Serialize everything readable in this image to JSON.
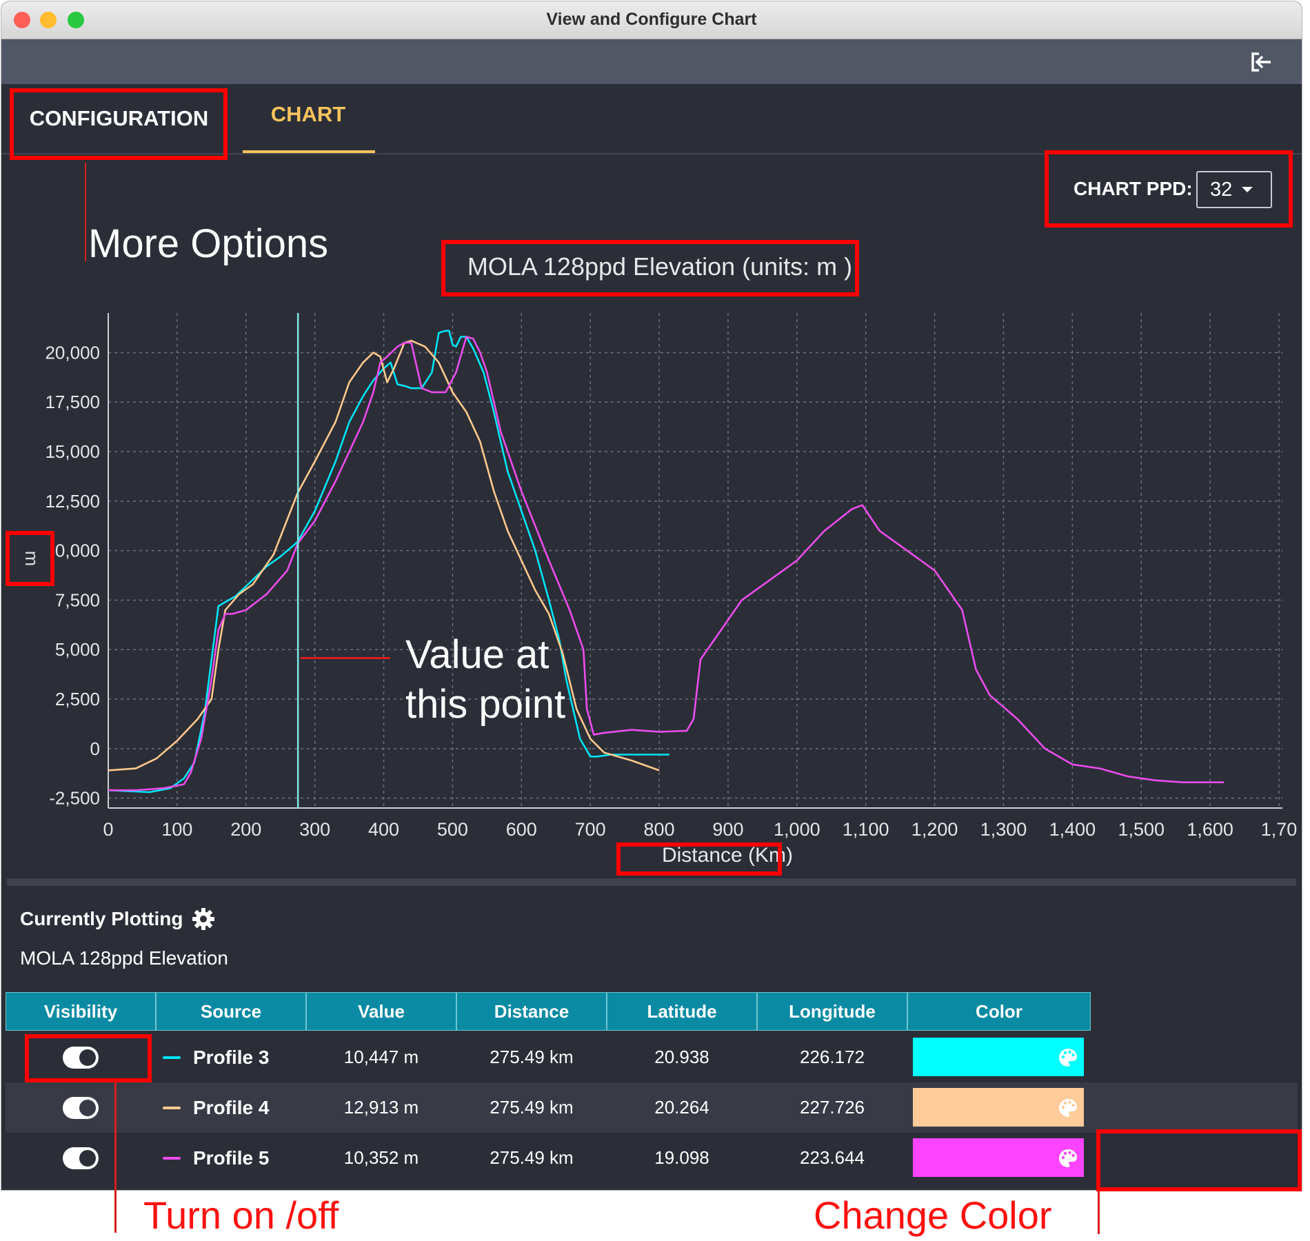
{
  "window": {
    "title": "View and Configure Chart"
  },
  "tabs": [
    {
      "label": "CONFIGURATION",
      "active": false
    },
    {
      "label": "CHART",
      "active": true
    }
  ],
  "ppd": {
    "label": "CHART PPD:",
    "value": "32"
  },
  "chart_data": {
    "type": "line",
    "title": "MOLA 128ppd Elevation (units: m )",
    "xlabel": "Distance (Km)",
    "ylabel": "m",
    "xlim": [
      0,
      1705
    ],
    "ylim": [
      -3000,
      22000
    ],
    "x_ticks": [
      "0",
      "100",
      "200",
      "300",
      "400",
      "500",
      "600",
      "700",
      "800",
      "900",
      "1,000",
      "1,100",
      "1,200",
      "1,300",
      "1,400",
      "1,500",
      "1,600",
      "1,70"
    ],
    "y_ticks": [
      "20,000",
      "17,500",
      "15,000",
      "12,500",
      "0,000",
      "7,500",
      "5,000",
      "2,500",
      "0",
      "-2,500"
    ],
    "grid": true,
    "cursor_x": 275.49,
    "series": [
      {
        "name": "Profile 3",
        "color": "#00e5f5",
        "x": [
          0,
          30,
          60,
          90,
          110,
          125,
          140,
          150,
          160,
          170,
          185,
          200,
          215,
          230,
          250,
          275,
          300,
          330,
          350,
          370,
          385,
          400,
          410,
          420,
          432,
          440,
          455,
          470,
          480,
          490,
          495,
          500,
          505,
          512,
          520,
          530,
          545,
          560,
          580,
          600,
          620,
          640,
          655,
          665,
          675,
          685,
          700,
          710,
          730,
          760,
          790,
          815
        ],
        "y": [
          -2100,
          -2150,
          -2200,
          -2000,
          -1500,
          -700,
          1800,
          4500,
          7200,
          7400,
          7700,
          8200,
          8700,
          9200,
          9700,
          10447,
          12000,
          14500,
          16500,
          17800,
          18600,
          19200,
          19500,
          18400,
          18300,
          18200,
          18200,
          19000,
          21000,
          21100,
          21100,
          20400,
          20300,
          20800,
          20800,
          20200,
          19000,
          17000,
          14000,
          12000,
          10000,
          7500,
          5500,
          3500,
          2000,
          500,
          -400,
          -400,
          -300,
          -300,
          -300,
          -300
        ]
      },
      {
        "name": "Profile 4",
        "color": "#ffc98e",
        "x": [
          0,
          40,
          70,
          100,
          130,
          150,
          160,
          170,
          190,
          210,
          240,
          275,
          300,
          330,
          350,
          370,
          385,
          395,
          405,
          415,
          430,
          440,
          460,
          480,
          500,
          520,
          540,
          560,
          580,
          600,
          620,
          640,
          660,
          680,
          700,
          720,
          760,
          800
        ],
        "y": [
          -1100,
          -1000,
          -500,
          400,
          1500,
          2500,
          5000,
          7000,
          7800,
          8300,
          9800,
          12913,
          14500,
          16500,
          18500,
          19500,
          20000,
          19800,
          18500,
          19200,
          20500,
          20600,
          20300,
          19500,
          18000,
          17000,
          15500,
          13000,
          11000,
          9500,
          8000,
          6800,
          4800,
          2000,
          500,
          -200,
          -600,
          -1100
        ]
      },
      {
        "name": "Profile 5",
        "color": "#ec4cec",
        "x": [
          0,
          40,
          80,
          110,
          120,
          135,
          150,
          160,
          170,
          180,
          200,
          230,
          260,
          275,
          300,
          330,
          350,
          370,
          385,
          395,
          405,
          420,
          430,
          440,
          455,
          470,
          490,
          505,
          520,
          530,
          540,
          550,
          570,
          600,
          640,
          670,
          690,
          695,
          705,
          720,
          760,
          800,
          840,
          850,
          860,
          880,
          920,
          960,
          1000,
          1040,
          1080,
          1095,
          1120,
          1160,
          1200,
          1240,
          1260,
          1280,
          1290,
          1320,
          1360,
          1400,
          1440,
          1480,
          1520,
          1560,
          1600,
          1620
        ],
        "y": [
          -2100,
          -2100,
          -2000,
          -1800,
          -1200,
          500,
          3500,
          6000,
          6800,
          6800,
          7000,
          7800,
          9000,
          10352,
          11500,
          13500,
          15000,
          16500,
          18000,
          19500,
          19800,
          20300,
          20500,
          20500,
          18200,
          18000,
          18000,
          19000,
          20800,
          20700,
          20000,
          19000,
          16000,
          13000,
          9500,
          7000,
          5000,
          2000,
          700,
          800,
          950,
          850,
          900,
          1500,
          4500,
          5500,
          7500,
          8500,
          9500,
          11000,
          12100,
          12300,
          11000,
          10000,
          9000,
          7000,
          4000,
          2700,
          2400,
          1500,
          0,
          -800,
          -1000,
          -1400,
          -1600,
          -1700,
          -1700,
          -1700
        ]
      }
    ]
  },
  "annotations": {
    "more_options": "More Options",
    "value_at_line1": "Value at",
    "value_at_line2": "this point",
    "turn_on_off": "Turn on /off",
    "change_color": "Change Color"
  },
  "panel": {
    "currently_plotting": "Currently Plotting",
    "dataset": "MOLA 128ppd Elevation"
  },
  "table": {
    "columns": [
      "Visibility",
      "Source",
      "Value",
      "Distance",
      "Latitude",
      "Longitude",
      "Color"
    ],
    "rows": [
      {
        "source": "Profile 3",
        "value": "10,447 m",
        "distance": "275.49 km",
        "latitude": "20.938",
        "longitude": "226.172",
        "color": "#00ffff",
        "visible": true
      },
      {
        "source": "Profile 4",
        "value": "12,913 m",
        "distance": "275.49 km",
        "latitude": "20.264",
        "longitude": "227.726",
        "color": "#ffcc99",
        "visible": true
      },
      {
        "source": "Profile 5",
        "value": "10,352 m",
        "distance": "275.49 km",
        "latitude": "19.098",
        "longitude": "223.644",
        "color": "#ff44ff",
        "visible": true
      }
    ]
  }
}
